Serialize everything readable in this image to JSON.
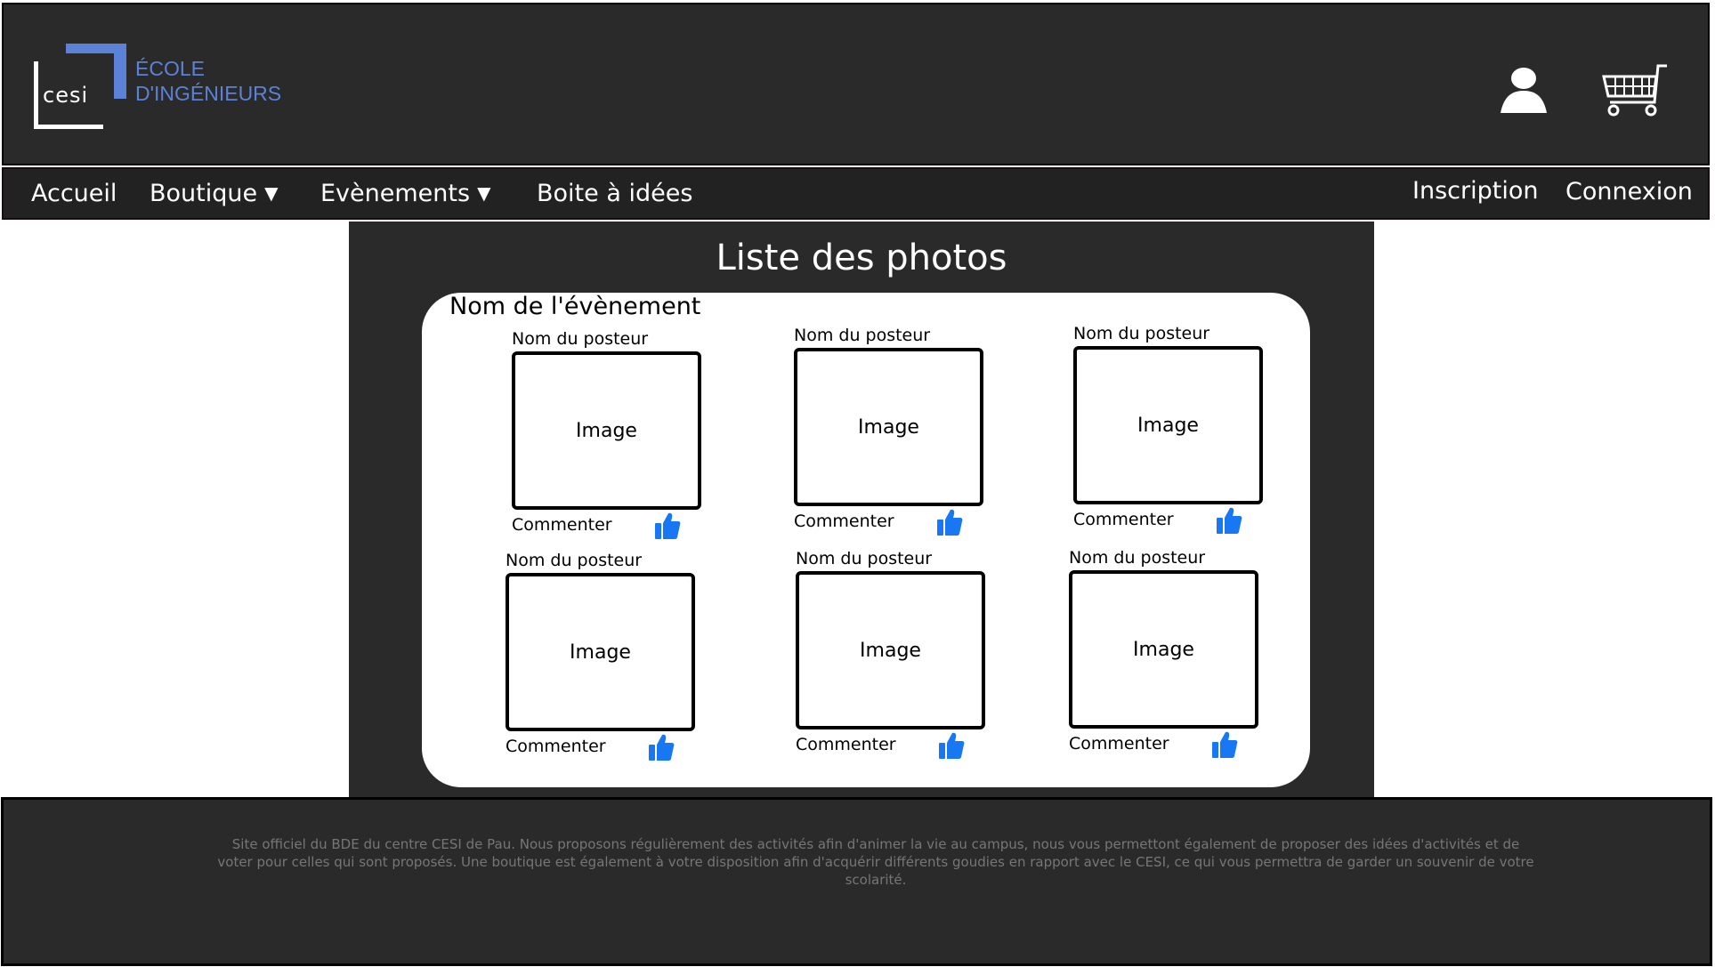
{
  "header": {
    "logo_wordmark": "cesi",
    "logo_line1": "ÉCOLE",
    "logo_line2": "D'INGÉNIEURS",
    "icons": [
      "user-icon",
      "cart-icon"
    ]
  },
  "nav": {
    "accueil": "Accueil",
    "boutique": "Boutique",
    "evenements": "Evènements",
    "boite": "Boite à idées",
    "inscription": "Inscription",
    "connexion": "Connexion",
    "caret": "▼"
  },
  "main": {
    "title": "Liste des photos",
    "event_name": "Nom de l'évènement",
    "photos": [
      {
        "poster": "Nom du posteur",
        "image": "Image",
        "comment": "Commenter"
      },
      {
        "poster": "Nom du posteur",
        "image": "Image",
        "comment": "Commenter"
      },
      {
        "poster": "Nom du posteur",
        "image": "Image",
        "comment": "Commenter"
      },
      {
        "poster": "Nom du posteur",
        "image": "Image",
        "comment": "Commenter"
      },
      {
        "poster": "Nom du posteur",
        "image": "Image",
        "comment": "Commenter"
      },
      {
        "poster": "Nom du posteur",
        "image": "Image",
        "comment": "Commenter"
      }
    ]
  },
  "footer": {
    "text": "Site officiel du BDE du centre CESI de Pau. Nous proposons régulièrement des activités afin d'animer la vie au campus, nous vous permettont également de proposer des idées d'activités et de voter pour celles qui sont proposés. Une boutique est également à votre disposition afin d'acquérir différents goudies en rapport avec le CESI, ce qui vous permettra de garder un souvenir de votre scolarité."
  },
  "colors": {
    "dark": "#2a2a2a",
    "brand_blue": "#5b82d6",
    "like_blue": "#1877f2"
  }
}
